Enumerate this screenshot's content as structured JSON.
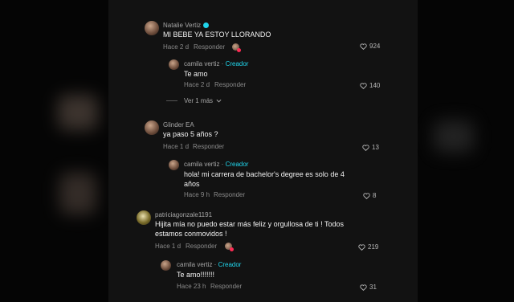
{
  "comments": [
    {
      "user": "Natalie Vertiz",
      "text": "MI BEBE YA ESTOY LLORANDO",
      "time": "Hace 2 d",
      "reply_label": "Responder",
      "likes": "924",
      "replies": [
        {
          "user": "camila vertiz",
          "badge": "Creador",
          "text": "Te amo",
          "time": "Hace 2 d",
          "reply_label": "Responder",
          "likes": "140"
        }
      ],
      "more_label": "Ver 1 más"
    },
    {
      "user": "Glinder EA",
      "text": "ya paso 5 años ?",
      "time": "Hace 1 d",
      "reply_label": "Responder",
      "likes": "13",
      "replies": [
        {
          "user": "camila vertiz",
          "badge": "Creador",
          "text_line1": "hola! mi carrera de bachelor's degree es solo de 4",
          "text_line2": "años",
          "time": "Hace 9 h",
          "reply_label": "Responder",
          "likes": "8"
        }
      ]
    },
    {
      "user": "patriciagonzale1191",
      "text_line1": "Hijita mía no puedo estar más feliz y orgullosa de ti ! Todos",
      "text_line2": "estamos conmovidos !",
      "time": "Hace 1 d",
      "reply_label": "Responder",
      "likes": "219",
      "replies": [
        {
          "user": "camila vertiz",
          "badge": "Creador",
          "text": "Te amo!!!!!!!",
          "time": "Hace 23 h",
          "reply_label": "Responder",
          "likes": "31"
        }
      ]
    }
  ],
  "icons": {
    "like": "heart-outline-icon",
    "verified": "verified-badge-icon",
    "expand": "chevron-down-icon"
  },
  "colors": {
    "background": "#121212",
    "accent": "#20d5ec",
    "muted": "#8a8a8a"
  }
}
